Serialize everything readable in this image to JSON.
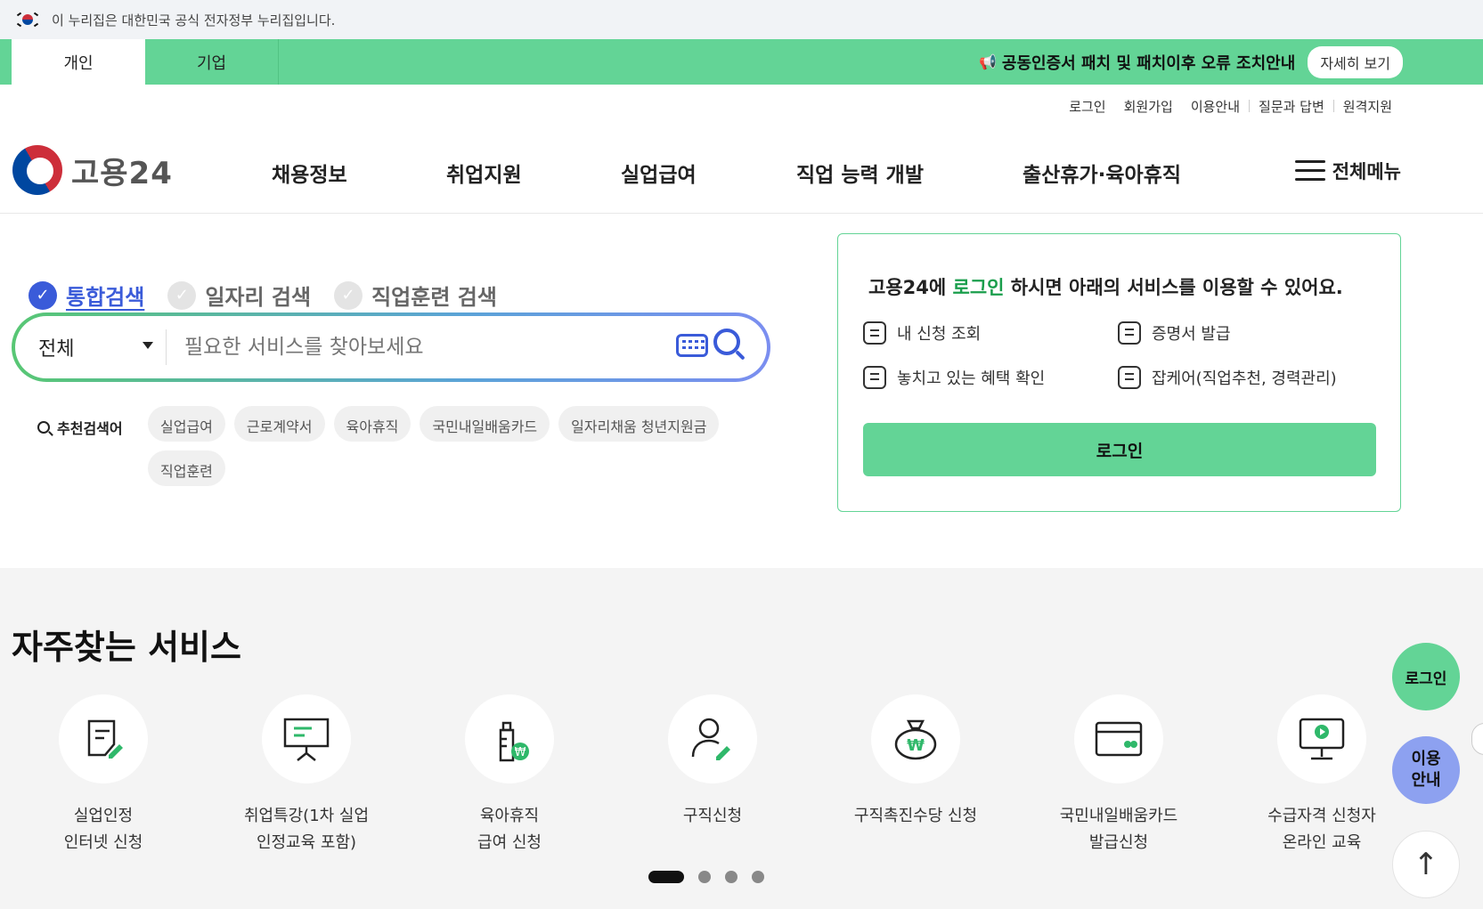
{
  "gov_banner": {
    "text": "이 누리집은 대한민국 공식 전자정부 누리집입니다."
  },
  "top_tabs": {
    "personal": "개인",
    "company": "기업"
  },
  "notice": {
    "text": "공동인증서 패치 및 패치이후 오류 조치안내",
    "button": "자세히 보기"
  },
  "util_links": [
    "로그인",
    "회원가입",
    "이용안내",
    "질문과 답변",
    "원격지원"
  ],
  "logo": {
    "text": "고용24"
  },
  "gnb": [
    "채용정보",
    "취업지원",
    "실업급여",
    "직업 능력 개발",
    "출산휴가·육아휴직"
  ],
  "all_menu": "전체메뉴",
  "search": {
    "tabs": [
      "통합검색",
      "일자리 검색",
      "직업훈련 검색"
    ],
    "active_tab": "통합검색",
    "select_value": "전체",
    "placeholder": "필요한 서비스를 찾아보세요",
    "recommend_label": "추천검색어",
    "keywords": [
      "실업급여",
      "근로계약서",
      "육아휴직",
      "국민내일배움카드",
      "일자리채움 청년지원금",
      "직업훈련"
    ]
  },
  "login_card": {
    "title_prefix": "고용24에 ",
    "title_link": "로그인",
    "title_suffix": " 하시면 아래의 서비스를 이용할 수 있어요.",
    "services": [
      "내 신청 조회",
      "증명서 발급",
      "놓치고 있는 혜택 확인",
      "잡케어(직업추천, 경력관리)"
    ],
    "button": "로그인"
  },
  "frequent": {
    "title": "자주찾는 서비스",
    "items": [
      {
        "line1": "실업인정",
        "line2": "인터넷 신청",
        "icon": "document-pen-icon"
      },
      {
        "line1": "취업특강(1차 실업",
        "line2": "인정교육 포함)",
        "icon": "presentation-board-icon"
      },
      {
        "line1": "육아휴직",
        "line2": "급여 신청",
        "icon": "baby-bottle-won-icon"
      },
      {
        "line1": "구직신청",
        "line2": "",
        "icon": "person-pen-icon"
      },
      {
        "line1": "구직촉진수당 신청",
        "line2": "",
        "icon": "money-bag-won-icon"
      },
      {
        "line1": "국민내일배움카드",
        "line2": "발급신청",
        "icon": "card-icon"
      },
      {
        "line1": "수급자격 신청자",
        "line2": "온라인 교육",
        "icon": "monitor-play-icon"
      }
    ],
    "pagination": {
      "pages": 4,
      "current": 1
    }
  },
  "floating": {
    "login": "로그인",
    "guide_line1": "이용",
    "guide_line2": "안내",
    "top": "↑"
  },
  "colors": {
    "brand_green": "#63d496",
    "accent_blue": "#3a5bd9",
    "guide_purple": "#8da1f0"
  }
}
